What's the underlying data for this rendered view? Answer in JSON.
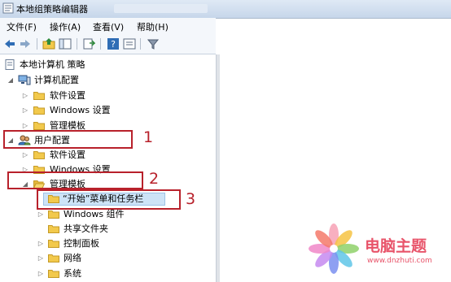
{
  "window": {
    "title": "本地组策略编辑器"
  },
  "menu": [
    "文件(F)",
    "操作(A)",
    "查看(V)",
    "帮助(H)"
  ],
  "toolbar": {
    "icons": [
      "back-arrow-icon",
      "forward-arrow-icon",
      "up-folder-icon",
      "show-hide-tree-icon",
      "export-list-icon",
      "help-icon",
      "properties-icon",
      "filter-icon"
    ]
  },
  "tree": {
    "root": "本地计算机 策略",
    "computer_config": "计算机配置",
    "cc_software": "软件设置",
    "cc_windows": "Windows 设置",
    "cc_admin": "管理模板",
    "user_config": "用户配置",
    "uc_software": "软件设置",
    "uc_windows": "Windows 设置",
    "uc_admin": "管理模板",
    "start_menu": "“开始”菜单和任务栏",
    "windows_components": "Windows 组件",
    "shared_folders": "共享文件夹",
    "control_panel": "控制面板",
    "network": "网络",
    "system": "系统"
  },
  "annotations": [
    "1",
    "2",
    "3"
  ],
  "watermark": {
    "brand": "电脑主题",
    "url": "www.dnzhuti.com"
  },
  "colors": {
    "highlight": "#b8212b",
    "folder": "#f2c94c",
    "selection": "#cde3f7"
  }
}
